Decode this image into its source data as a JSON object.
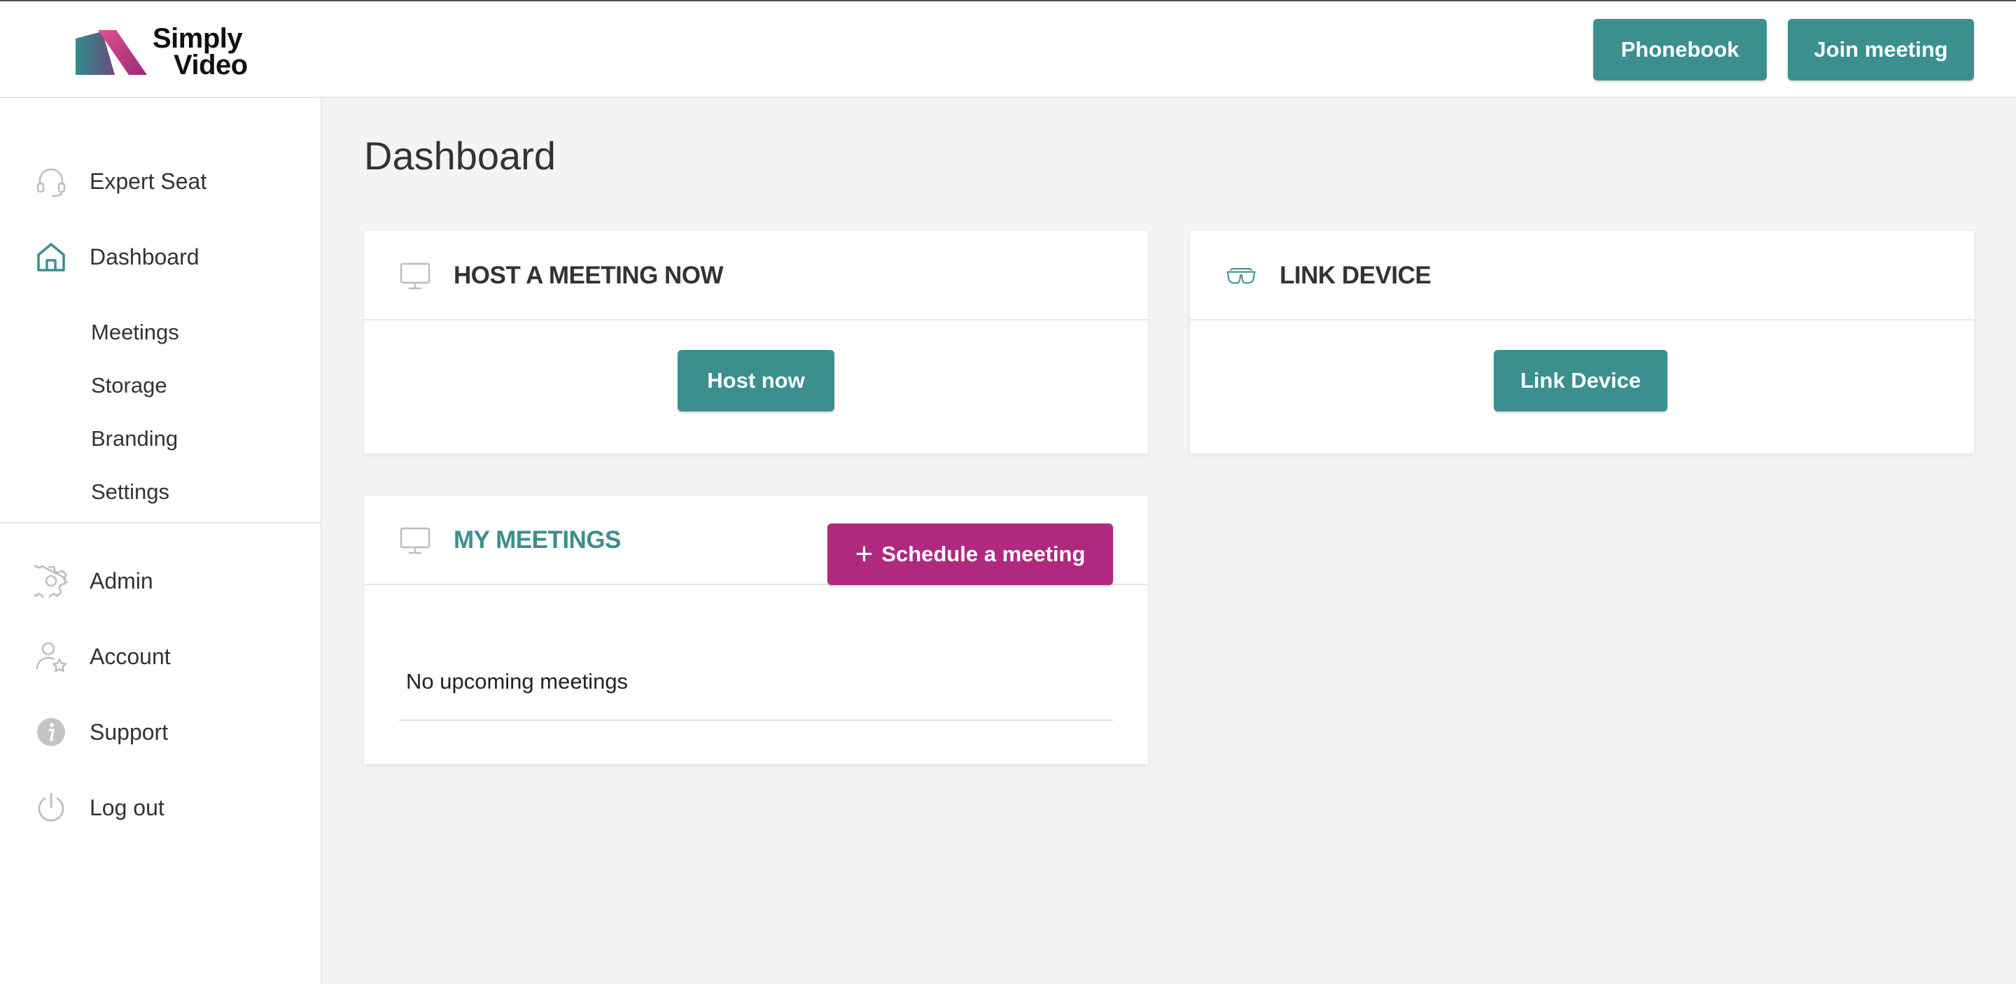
{
  "brand": {
    "line1": "Simply",
    "line2": "Video",
    "accent": "#3b8f8f",
    "magenta": "#b0287f"
  },
  "header": {
    "phonebook_label": "Phonebook",
    "join_label": "Join meeting"
  },
  "sidebar": {
    "items": [
      {
        "label": "Expert Seat",
        "icon": "headset-icon"
      },
      {
        "label": "Dashboard",
        "icon": "home-icon"
      }
    ],
    "sub_items": [
      "Meetings",
      "Storage",
      "Branding",
      "Settings"
    ],
    "lower_items": [
      {
        "label": "Admin",
        "icon": "gear-icon"
      },
      {
        "label": "Account",
        "icon": "user-star-icon"
      },
      {
        "label": "Support",
        "icon": "info-icon"
      },
      {
        "label": "Log out",
        "icon": "power-icon"
      }
    ]
  },
  "main": {
    "title": "Dashboard",
    "host_card": {
      "title": "HOST A MEETING NOW",
      "icon": "monitor-icon",
      "button": "Host now"
    },
    "link_card": {
      "title": "LINK DEVICE",
      "icon": "smart-glasses-icon",
      "button": "Link Device"
    },
    "meetings_card": {
      "title": "MY MEETINGS",
      "icon": "monitor-icon",
      "button": "Schedule a meeting",
      "empty": "No upcoming meetings"
    }
  }
}
